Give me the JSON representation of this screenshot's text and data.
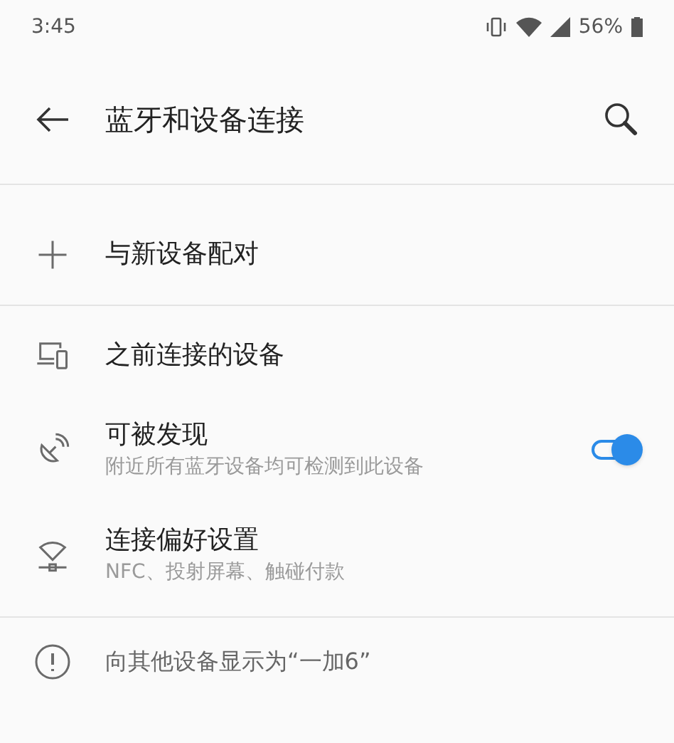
{
  "status_bar": {
    "time": "3:45",
    "battery": "56%"
  },
  "header": {
    "title": "蓝牙和设备连接"
  },
  "sections": [
    [
      {
        "kind": "add",
        "title": "与新设备配对"
      }
    ],
    [
      {
        "kind": "devices",
        "title": "之前连接的设备"
      },
      {
        "kind": "radar",
        "title": "可被发现",
        "subtitle": "附近所有蓝牙设备均可检测到此设备",
        "on": true
      },
      {
        "kind": "prefs",
        "title": "连接偏好设置",
        "subtitle": "NFC、投射屏幕、触碰付款"
      }
    ]
  ],
  "footer": {
    "text": "向其他设备显示为“一加6”"
  }
}
